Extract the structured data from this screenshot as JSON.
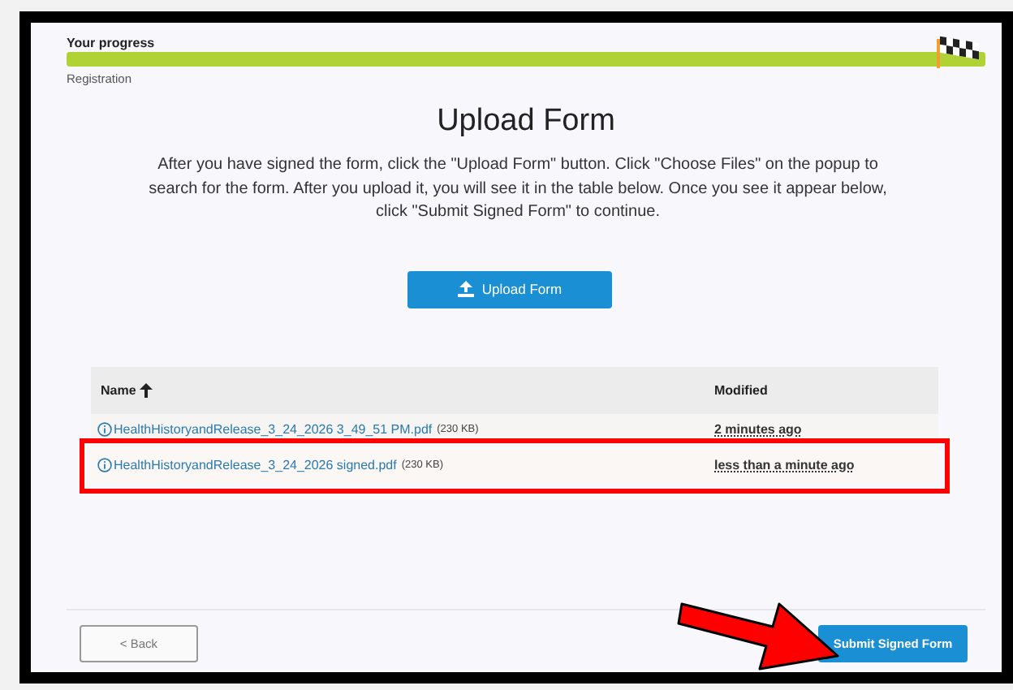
{
  "progress": {
    "label": "Your progress",
    "level": 1,
    "step": "Registration"
  },
  "title": "Upload Form",
  "instructions": "After you have signed the form, click the \"Upload Form\" button. Click \"Choose Files\" on the popup to search for the form. After you upload it, you will see it in the table below. Once you see it appear below, click \"Submit Signed Form\" to continue.",
  "upload_button": "Upload Form",
  "table": {
    "columns": [
      {
        "label": "Name",
        "sorted": true
      },
      {
        "label": "Modified",
        "sorted": false
      }
    ],
    "rows": [
      {
        "file": "HealthHistoryandRelease_3_24_2026 3_49_51 PM.pdf",
        "size": "(230 KB)",
        "modified": "2 minutes ago",
        "highlighted": false
      },
      {
        "file": "HealthHistoryandRelease_3_24_2026 signed.pdf",
        "size": "(230 KB)",
        "modified": "less than a minute ago",
        "highlighted": true
      }
    ]
  },
  "buttons": {
    "back": "< Back",
    "submit": "Submit Signed Form"
  }
}
